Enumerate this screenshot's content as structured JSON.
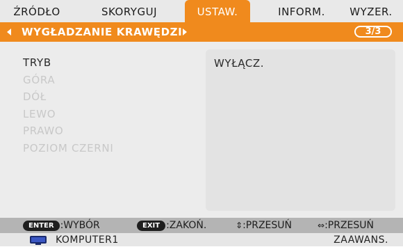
{
  "tabs": [
    {
      "label": "ŹRÓDŁO",
      "active": false
    },
    {
      "label": "SKORYGUJ",
      "active": false
    },
    {
      "label": "USTAW.",
      "active": true
    },
    {
      "label": "INFORM.",
      "active": false
    },
    {
      "label": "WYZER.",
      "active": false
    }
  ],
  "title": {
    "text": "WYGŁADZANIE KRAWĘDZI",
    "page": "3/3"
  },
  "options": [
    {
      "label": "TRYB",
      "enabled": true
    },
    {
      "label": "GÓRA",
      "enabled": false
    },
    {
      "label": "DÓŁ",
      "enabled": false
    },
    {
      "label": "LEWO",
      "enabled": false
    },
    {
      "label": "PRAWO",
      "enabled": false
    },
    {
      "label": "POZIOM CZERNI",
      "enabled": false
    }
  ],
  "value": "WYŁĄCZ.",
  "hints": {
    "enter_key": "ENTER",
    "enter_label": ":WYBÓR",
    "exit_key": "EXIT",
    "exit_label": ":ZAKOŃ.",
    "updown_glyph": "⇕",
    "updown_label": ":PRZESUŃ",
    "leftright_glyph": "⇔",
    "leftright_label": ":PRZESUŃ"
  },
  "status": {
    "source": "KOMPUTER1",
    "mode": "ZAAWANS.",
    "icon": "monitor-icon"
  },
  "colors": {
    "accent": "#f08a1d",
    "disabled_text": "#c8c8c8",
    "hint_bar": "#b4b4b4"
  }
}
